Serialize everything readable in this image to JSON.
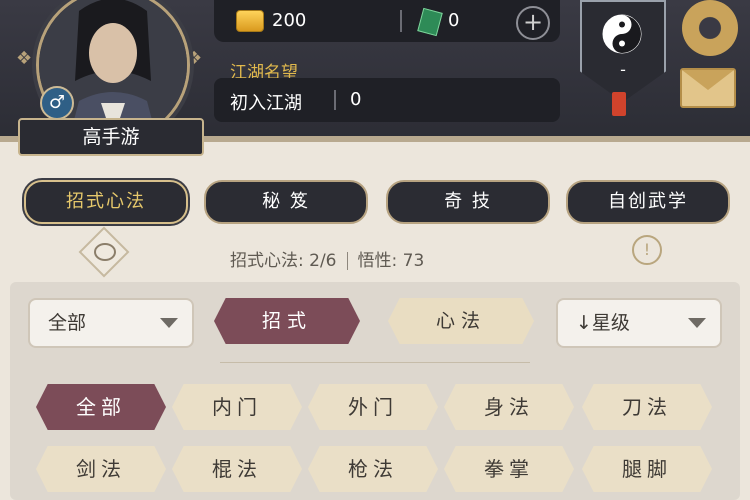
{
  "player": {
    "name": "高手游",
    "gender_symbol": "♂"
  },
  "currency": {
    "gold": "200",
    "jade": "0",
    "add_label": "+"
  },
  "reputation": {
    "label": "江湖名望",
    "rank": "初入江湖",
    "value": "0"
  },
  "sect": {
    "value": "-"
  },
  "tabs": [
    {
      "label": "招式心法"
    },
    {
      "label": "秘 笈"
    },
    {
      "label": "奇 技"
    },
    {
      "label": "自创武学"
    }
  ],
  "stats": {
    "moves_label": "招式心法: 2/6",
    "insight_label": "悟性: 73",
    "info_glyph": "!"
  },
  "filters": {
    "range_dropdown": "全部",
    "type_moves": "招式",
    "type_skills": "心法",
    "sort_dropdown": "↓星级"
  },
  "categories": [
    {
      "label": "全部"
    },
    {
      "label": "内门"
    },
    {
      "label": "外门"
    },
    {
      "label": "身法"
    },
    {
      "label": "刀法"
    },
    {
      "label": "剑法"
    },
    {
      "label": "棍法"
    },
    {
      "label": "枪法"
    },
    {
      "label": "拳掌"
    },
    {
      "label": "腿脚"
    }
  ]
}
